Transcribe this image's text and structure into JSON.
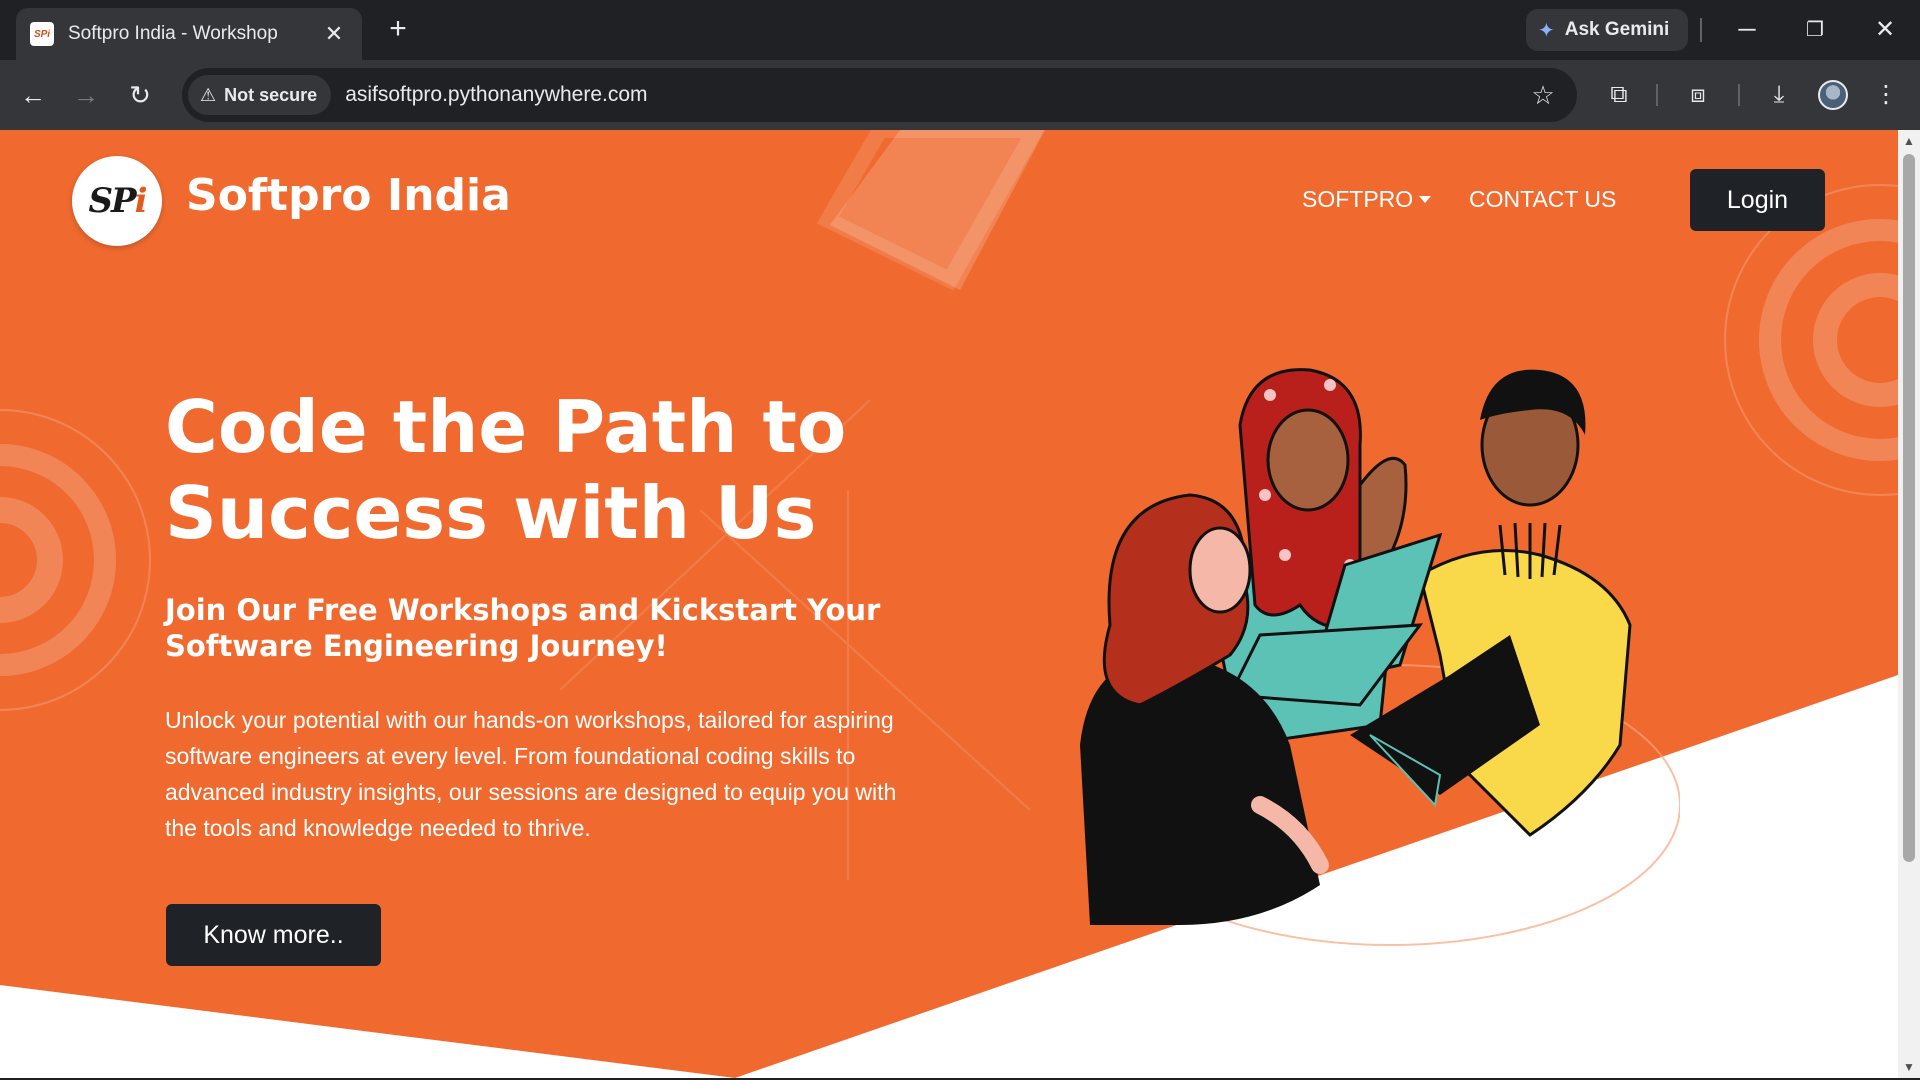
{
  "browser": {
    "tab_title": "Softpro India - Workshop",
    "gemini_label": "Ask Gemini",
    "security_label": "Not secure",
    "url": "asifsoftpro.pythonanywhere.com"
  },
  "site": {
    "brand": "Softpro India",
    "logo_mark": "SPi",
    "nav": {
      "softpro": "SOFTPRO",
      "contact": "CONTACT US",
      "login": "Login"
    },
    "hero": {
      "title": "Code the Path to Success with Us",
      "subtitle": "Join Our Free Workshops and Kickstart Your Software Engineering Journey!",
      "body": "Unlock your potential with our hands-on workshops, tailored for aspiring software engineers at every level. From foundational coding skills to advanced industry insights, our sessions are designed to equip you with the tools and knowledge needed to thrive.",
      "cta": "Know more.."
    }
  },
  "colors": {
    "hero_orange": "#f06a2f",
    "button_dark": "#1f2328"
  }
}
